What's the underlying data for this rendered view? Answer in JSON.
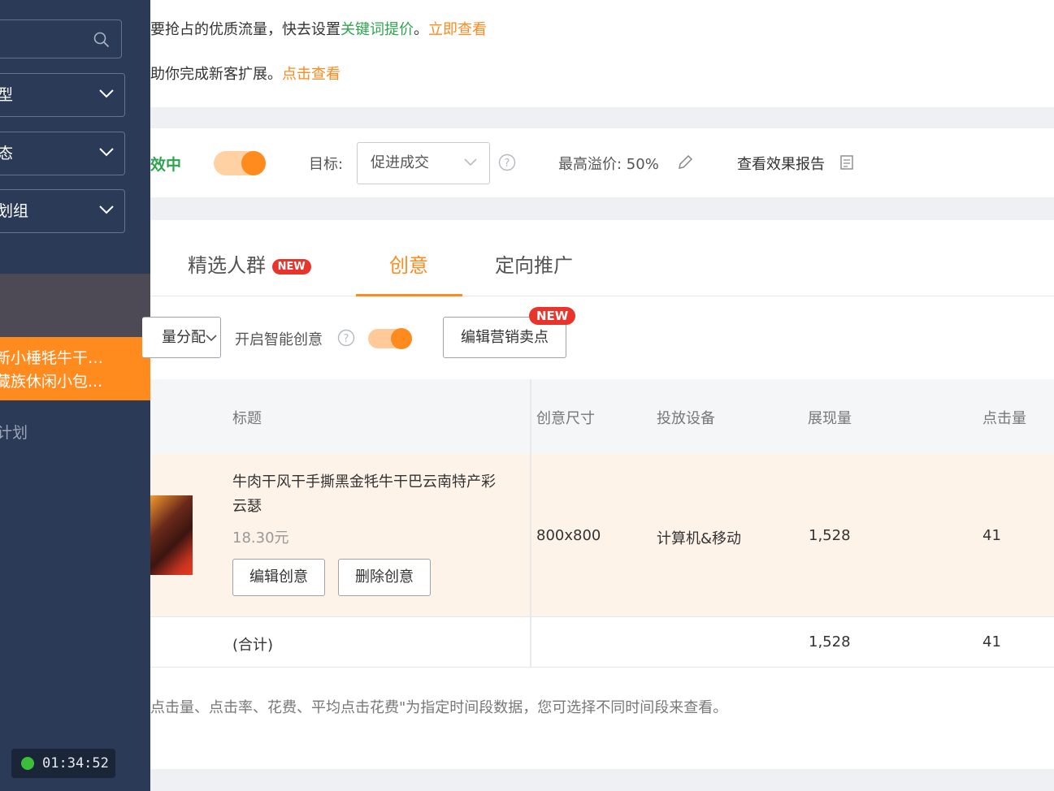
{
  "sidebar": {
    "filters": [
      "型",
      "态",
      "划组"
    ],
    "active_item": [
      "新小棰牦牛干巴云",
      "藏族休闲小包..."
    ],
    "plan_label": "计划",
    "timer": "01:34:52"
  },
  "notice": {
    "line1_prefix": "要抢占的优质流量，快去设置",
    "line1_keyword": "关键词提价",
    "line1_sep": "。",
    "line1_link": "立即查看",
    "line2_text": "助你完成新客扩展。",
    "line2_link": "点击查看"
  },
  "status": {
    "state_label": "效中",
    "goal_label": "目标:",
    "goal_value": "促进成交",
    "max_premium": "最高溢价: 50%",
    "report_link": "查看效果报告"
  },
  "tabs": {
    "items": [
      "精选人群",
      "创意",
      "定向推广"
    ],
    "new_badge": "NEW",
    "active": "创意"
  },
  "toolbar": {
    "alloc_label": "量分配",
    "smart_label": "开启智能创意",
    "edit_selling_points": "编辑营销卖点",
    "new_badge": "NEW"
  },
  "table": {
    "headers": [
      "标题",
      "创意尺寸",
      "投放设备",
      "展现量",
      "点击量"
    ],
    "row": {
      "title_line1": "牛肉干风干手撕黑金牦牛干巴云南特产彩",
      "title_line2": "云瑟",
      "price": "18.30元",
      "size": "800x800",
      "device": "计算机&移动",
      "impressions": "1,528",
      "clicks": "41",
      "edit_button": "编辑创意",
      "delete_button": "删除创意"
    },
    "summary": {
      "label": "(合计)",
      "impressions": "1,528",
      "clicks": "41"
    }
  },
  "footnote": "点击量、点击率、花费、平均点击花费\"为指定时间段数据，您可选择不同时间段来查看。",
  "colors": {
    "accent": "#ff8a1e",
    "sidebar": "#2b3a56",
    "green": "#2ea44f",
    "badge": "#e8342a"
  }
}
